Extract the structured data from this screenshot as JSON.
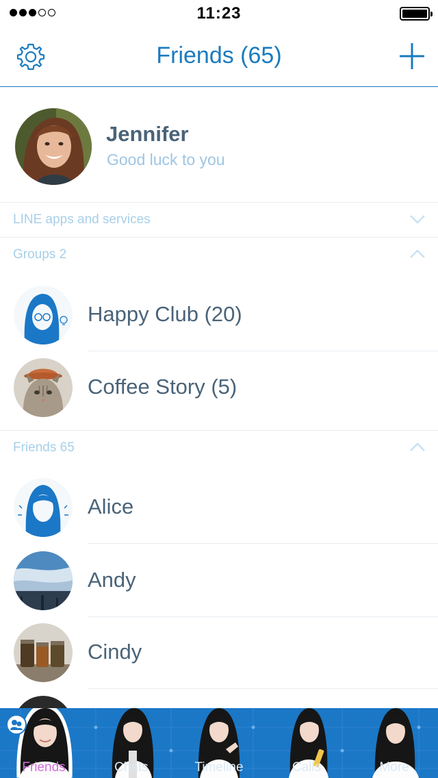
{
  "status_bar": {
    "signal_dots_filled": 3,
    "signal_dots_total": 5,
    "time": "11:23",
    "battery_level": 1.0
  },
  "nav": {
    "title": "Friends (65)",
    "left_icon": "gear-icon",
    "right_icon": "plus-icon"
  },
  "profile": {
    "name": "Jennifer",
    "status": "Good luck to you"
  },
  "sections": {
    "services": {
      "label": "LINE apps and services",
      "state": "collapsed"
    },
    "groups": {
      "label": "Groups 2",
      "state": "expanded"
    },
    "friends": {
      "label": "Friends 65",
      "state": "expanded"
    }
  },
  "groups": [
    {
      "name": "Happy Club (20)",
      "avatar": "girl-sketch-with-lightbulb"
    },
    {
      "name": "Coffee Story (5)",
      "avatar": "cat-with-hat-photo"
    }
  ],
  "friends": [
    {
      "name": "Alice",
      "avatar": "girl-sketch-silhouette"
    },
    {
      "name": "Andy",
      "avatar": "sky-landscape-photo"
    },
    {
      "name": "Cindy",
      "avatar": "jars-photo"
    }
  ],
  "tabs": [
    {
      "label": "Friends",
      "active": true
    },
    {
      "label": "Chats",
      "active": false
    },
    {
      "label": "Timeline",
      "active": false
    },
    {
      "label": "Calls",
      "active": false
    },
    {
      "label": "More",
      "active": false
    }
  ],
  "colors": {
    "accent": "#1a7bbf",
    "text": "#4a6378",
    "muted": "#a7cfe8",
    "tab_bar": "#1b78c7",
    "active_tab": "#d06ed8"
  }
}
